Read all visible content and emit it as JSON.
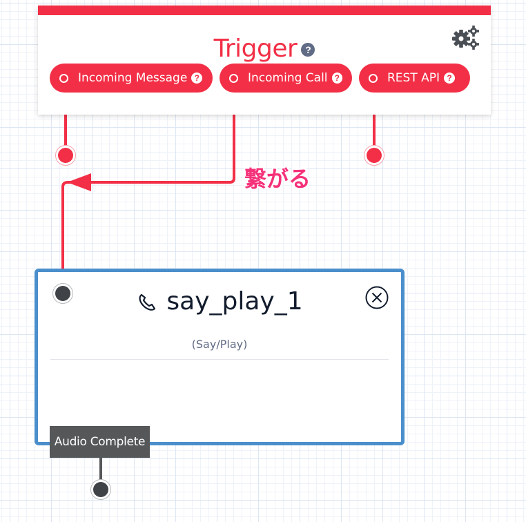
{
  "trigger": {
    "title": "Trigger",
    "help_glyph": "?",
    "settings_icon": "gears-icon",
    "options": [
      {
        "label": "Incoming Message",
        "icon": "radio-empty-icon",
        "help_glyph": "?"
      },
      {
        "label": "Incoming Call",
        "icon": "radio-empty-icon",
        "help_glyph": "?"
      },
      {
        "label": "REST API",
        "icon": "radio-empty-icon",
        "help_glyph": "?"
      }
    ]
  },
  "annotation": {
    "text": "繋がる"
  },
  "widget": {
    "title": "say_play_1",
    "type_label": "(Say/Play)",
    "icon": "phone-icon",
    "close_icon": "close-circle-icon",
    "transition_label": "Audio Complete"
  },
  "colors": {
    "accent_red": "#f22f46",
    "widget_border": "#4a8fcc",
    "annotation_pink": "#f5327a",
    "transition_bg": "#555759"
  }
}
